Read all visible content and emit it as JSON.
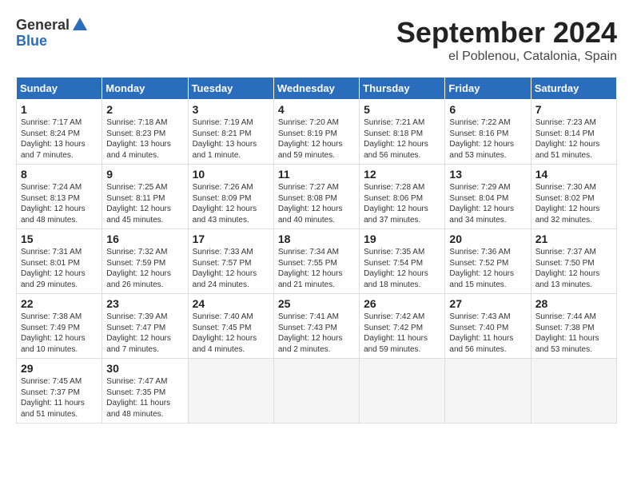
{
  "logo": {
    "general": "General",
    "blue": "Blue"
  },
  "title": {
    "month": "September 2024",
    "location": "el Poblenou, Catalonia, Spain"
  },
  "headers": [
    "Sunday",
    "Monday",
    "Tuesday",
    "Wednesday",
    "Thursday",
    "Friday",
    "Saturday"
  ],
  "weeks": [
    [
      {
        "day": "1",
        "info": "Sunrise: 7:17 AM\nSunset: 8:24 PM\nDaylight: 13 hours\nand 7 minutes."
      },
      {
        "day": "2",
        "info": "Sunrise: 7:18 AM\nSunset: 8:23 PM\nDaylight: 13 hours\nand 4 minutes."
      },
      {
        "day": "3",
        "info": "Sunrise: 7:19 AM\nSunset: 8:21 PM\nDaylight: 13 hours\nand 1 minute."
      },
      {
        "day": "4",
        "info": "Sunrise: 7:20 AM\nSunset: 8:19 PM\nDaylight: 12 hours\nand 59 minutes."
      },
      {
        "day": "5",
        "info": "Sunrise: 7:21 AM\nSunset: 8:18 PM\nDaylight: 12 hours\nand 56 minutes."
      },
      {
        "day": "6",
        "info": "Sunrise: 7:22 AM\nSunset: 8:16 PM\nDaylight: 12 hours\nand 53 minutes."
      },
      {
        "day": "7",
        "info": "Sunrise: 7:23 AM\nSunset: 8:14 PM\nDaylight: 12 hours\nand 51 minutes."
      }
    ],
    [
      {
        "day": "8",
        "info": "Sunrise: 7:24 AM\nSunset: 8:13 PM\nDaylight: 12 hours\nand 48 minutes."
      },
      {
        "day": "9",
        "info": "Sunrise: 7:25 AM\nSunset: 8:11 PM\nDaylight: 12 hours\nand 45 minutes."
      },
      {
        "day": "10",
        "info": "Sunrise: 7:26 AM\nSunset: 8:09 PM\nDaylight: 12 hours\nand 43 minutes."
      },
      {
        "day": "11",
        "info": "Sunrise: 7:27 AM\nSunset: 8:08 PM\nDaylight: 12 hours\nand 40 minutes."
      },
      {
        "day": "12",
        "info": "Sunrise: 7:28 AM\nSunset: 8:06 PM\nDaylight: 12 hours\nand 37 minutes."
      },
      {
        "day": "13",
        "info": "Sunrise: 7:29 AM\nSunset: 8:04 PM\nDaylight: 12 hours\nand 34 minutes."
      },
      {
        "day": "14",
        "info": "Sunrise: 7:30 AM\nSunset: 8:02 PM\nDaylight: 12 hours\nand 32 minutes."
      }
    ],
    [
      {
        "day": "15",
        "info": "Sunrise: 7:31 AM\nSunset: 8:01 PM\nDaylight: 12 hours\nand 29 minutes."
      },
      {
        "day": "16",
        "info": "Sunrise: 7:32 AM\nSunset: 7:59 PM\nDaylight: 12 hours\nand 26 minutes."
      },
      {
        "day": "17",
        "info": "Sunrise: 7:33 AM\nSunset: 7:57 PM\nDaylight: 12 hours\nand 24 minutes."
      },
      {
        "day": "18",
        "info": "Sunrise: 7:34 AM\nSunset: 7:55 PM\nDaylight: 12 hours\nand 21 minutes."
      },
      {
        "day": "19",
        "info": "Sunrise: 7:35 AM\nSunset: 7:54 PM\nDaylight: 12 hours\nand 18 minutes."
      },
      {
        "day": "20",
        "info": "Sunrise: 7:36 AM\nSunset: 7:52 PM\nDaylight: 12 hours\nand 15 minutes."
      },
      {
        "day": "21",
        "info": "Sunrise: 7:37 AM\nSunset: 7:50 PM\nDaylight: 12 hours\nand 13 minutes."
      }
    ],
    [
      {
        "day": "22",
        "info": "Sunrise: 7:38 AM\nSunset: 7:49 PM\nDaylight: 12 hours\nand 10 minutes."
      },
      {
        "day": "23",
        "info": "Sunrise: 7:39 AM\nSunset: 7:47 PM\nDaylight: 12 hours\nand 7 minutes."
      },
      {
        "day": "24",
        "info": "Sunrise: 7:40 AM\nSunset: 7:45 PM\nDaylight: 12 hours\nand 4 minutes."
      },
      {
        "day": "25",
        "info": "Sunrise: 7:41 AM\nSunset: 7:43 PM\nDaylight: 12 hours\nand 2 minutes."
      },
      {
        "day": "26",
        "info": "Sunrise: 7:42 AM\nSunset: 7:42 PM\nDaylight: 11 hours\nand 59 minutes."
      },
      {
        "day": "27",
        "info": "Sunrise: 7:43 AM\nSunset: 7:40 PM\nDaylight: 11 hours\nand 56 minutes."
      },
      {
        "day": "28",
        "info": "Sunrise: 7:44 AM\nSunset: 7:38 PM\nDaylight: 11 hours\nand 53 minutes."
      }
    ],
    [
      {
        "day": "29",
        "info": "Sunrise: 7:45 AM\nSunset: 7:37 PM\nDaylight: 11 hours\nand 51 minutes."
      },
      {
        "day": "30",
        "info": "Sunrise: 7:47 AM\nSunset: 7:35 PM\nDaylight: 11 hours\nand 48 minutes."
      },
      {
        "day": "",
        "info": ""
      },
      {
        "day": "",
        "info": ""
      },
      {
        "day": "",
        "info": ""
      },
      {
        "day": "",
        "info": ""
      },
      {
        "day": "",
        "info": ""
      }
    ]
  ]
}
